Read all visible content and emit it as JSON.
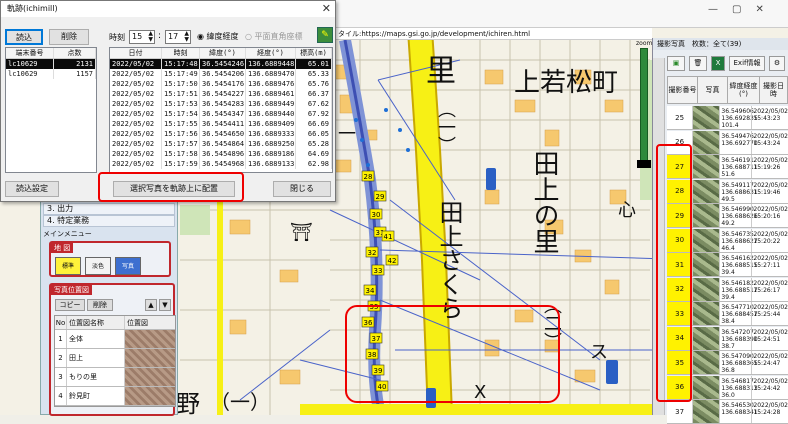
{
  "browser": {
    "url": "タイル:https://maps.gsi.go.jp/development/ichiren.html"
  },
  "map": {
    "labels": [
      "里",
      "上若松町",
      "田上さくら",
      "田上の里",
      "（一）",
      "（二）",
      "（一）",
      "ス",
      "X",
      "野",
      "（一）"
    ],
    "route_numbers": [
      "28",
      "29",
      "30",
      "31",
      "32",
      "33",
      "34",
      "35",
      "36",
      "37",
      "38",
      "39",
      "40",
      "41",
      "42"
    ],
    "zoom_label": "zoom"
  },
  "dialog": {
    "title": "軌跡(ichimill)",
    "close": "✕",
    "load_button": "読込",
    "delete_button": "削除",
    "time_label": "時刻",
    "hour": "15",
    "minute": "17",
    "radio_latlon": "緯度経度",
    "radio_plane": "平面直角座標",
    "device_headers": [
      "端末番号",
      "点数"
    ],
    "devices": [
      {
        "id": "lc10629",
        "count": "2131"
      },
      {
        "id": "lc10629",
        "count": "1157"
      }
    ],
    "track_headers": [
      "日付",
      "時刻",
      "緯度(°)",
      "経度(°)",
      "標高(m)"
    ],
    "track_rows": [
      [
        "2022/05/02",
        "15:17:48",
        "36.5454246",
        "136.6889448",
        "65.01"
      ],
      [
        "2022/05/02",
        "15:17:49",
        "36.5454206",
        "136.6889470",
        "65.33"
      ],
      [
        "2022/05/02",
        "15:17:50",
        "36.5454176",
        "136.6889476",
        "65.76"
      ],
      [
        "2022/05/02",
        "15:17:51",
        "36.5454227",
        "136.6889461",
        "66.37"
      ],
      [
        "2022/05/02",
        "15:17:53",
        "36.5454283",
        "136.6889449",
        "67.62"
      ],
      [
        "2022/05/02",
        "15:17:54",
        "36.5454347",
        "136.6889440",
        "67.92"
      ],
      [
        "2022/05/02",
        "15:17:55",
        "36.5454411",
        "136.6889409",
        "66.69"
      ],
      [
        "2022/05/02",
        "15:17:56",
        "36.5454650",
        "136.6889333",
        "66.05"
      ],
      [
        "2022/05/02",
        "15:17:57",
        "36.5454864",
        "136.6889250",
        "65.28"
      ],
      [
        "2022/05/02",
        "15:17:58",
        "36.5454896",
        "136.6889186",
        "64.69"
      ],
      [
        "2022/05/02",
        "15:17:59",
        "36.5454968",
        "136.6889133",
        "62.98"
      ]
    ],
    "read_settings_button": "読込設定",
    "place_button": "選択写真を軌跡上に配置",
    "close_button": "閉じる"
  },
  "left_panel": {
    "item_list": [
      "3. 出力",
      "4. 特定業務"
    ],
    "menu": "メインメニュー",
    "map_group": "地 図",
    "map_types": [
      "標準",
      "淡色",
      "写真"
    ],
    "photo_group": "写真位置図",
    "copy_button": "コピー",
    "delete_button": "削除",
    "table_headers": [
      "No",
      "位置図名称",
      "位置図"
    ],
    "rows": [
      {
        "no": "1",
        "name": "全体"
      },
      {
        "no": "2",
        "name": "田上"
      },
      {
        "no": "3",
        "name": "もりの里"
      },
      {
        "no": "4",
        "name": "鈴見町"
      }
    ]
  },
  "right_panel": {
    "header": "撮影写真　枚数：全て(39)",
    "exif_button": "Exif情報",
    "table_headers": [
      "撮影番号",
      "写真",
      "緯度経度(°)",
      "撮影日時"
    ],
    "photos": [
      {
        "no": "25",
        "lat": "36.549606",
        "lon": "136.692835",
        "ele": "101.4",
        "date": "2022/05/02",
        "time": "15:43:23"
      },
      {
        "no": "26",
        "lat": "36.549476",
        "lon": "136.692770",
        "ele": "",
        "date": "2022/05/02",
        "time": "15:43:24"
      },
      {
        "no": "27",
        "lat": "36.546191",
        "lon": "136.688711",
        "ele": "51.6",
        "date": "2022/05/02",
        "time": "15:19:26"
      },
      {
        "no": "28",
        "lat": "36.549117",
        "lon": "136.688631",
        "ele": "49.5",
        "date": "2022/05/02",
        "time": "15:19:46"
      },
      {
        "no": "29",
        "lat": "36.546990",
        "lon": "136.688626",
        "ele": "49.2",
        "date": "2022/05/02",
        "time": "15:20:16"
      },
      {
        "no": "30",
        "lat": "36.546735",
        "lon": "136.688627",
        "ele": "46.4",
        "date": "2022/05/02",
        "time": "15:20:22"
      },
      {
        "no": "31",
        "lat": "36.546162",
        "lon": "136.688515",
        "ele": "39.4",
        "date": "2022/05/02",
        "time": "15:27:11"
      },
      {
        "no": "32",
        "lat": "36.546182",
        "lon": "136.688517",
        "ele": "39.4",
        "date": "2022/05/02",
        "time": "15:26:17"
      },
      {
        "no": "33",
        "lat": "36.547710",
        "lon": "136.688457",
        "ele": "38.4",
        "date": "2022/05/02",
        "time": "15:25:44"
      },
      {
        "no": "34",
        "lat": "36.547207",
        "lon": "136.688390",
        "ele": "38.7",
        "date": "2022/05/02",
        "time": "15:24:51"
      },
      {
        "no": "35",
        "lat": "36.547090",
        "lon": "136.688365",
        "ele": "36.8",
        "date": "2022/05/02",
        "time": "15:24:47"
      },
      {
        "no": "36",
        "lat": "36.546817",
        "lon": "136.688313",
        "ele": "36.0",
        "date": "2022/05/02",
        "time": "15:24:42"
      },
      {
        "no": "37",
        "lat": "36.546530",
        "lon": "136.688341",
        "ele": "",
        "date": "2022/05/02",
        "time": "15:24:28"
      }
    ]
  },
  "colors": {
    "highlight": "#fff200",
    "accent_red": "#e00000",
    "road_yellow": "#f7f015",
    "river_blue": "#3d4fb3"
  }
}
